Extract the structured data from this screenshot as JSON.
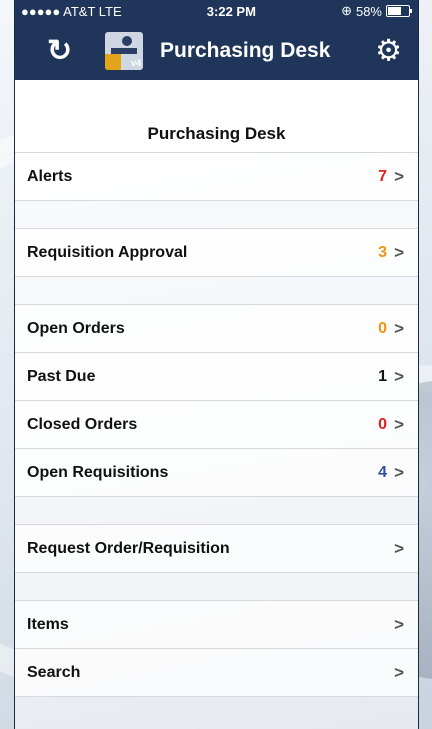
{
  "status_bar": {
    "carrier": "●●●●● AT&T  LTE",
    "time": "3:22 PM",
    "battery": "58%",
    "battery_level": 0.58
  },
  "nav": {
    "title": "Purchasing Desk",
    "logo_version": "v4",
    "icons": {
      "refresh": "refresh-icon",
      "settings": "gear-icon"
    }
  },
  "section": {
    "title": "Purchasing Desk"
  },
  "colors": {
    "nav_background": "#1f3559",
    "alerts_count": "#e02020",
    "requisition_count": "#f0960e",
    "open_orders_count": "#f0960e",
    "past_due_count": "#111111",
    "closed_orders_count": "#e02020",
    "open_requisitions_count": "#2f4fa3"
  },
  "menu": {
    "alerts": {
      "label": "Alerts",
      "count": "7"
    },
    "requisition_approval": {
      "label": "Requisition Approval",
      "count": "3"
    },
    "open_orders": {
      "label": "Open Orders",
      "count": "0"
    },
    "past_due": {
      "label": "Past Due",
      "count": "1"
    },
    "closed_orders": {
      "label": "Closed Orders",
      "count": "0"
    },
    "open_requisitions": {
      "label": "Open Requisitions",
      "count": "4"
    },
    "request_order": {
      "label": "Request Order/Requisition"
    },
    "items": {
      "label": "Items"
    },
    "search": {
      "label": "Search"
    }
  }
}
